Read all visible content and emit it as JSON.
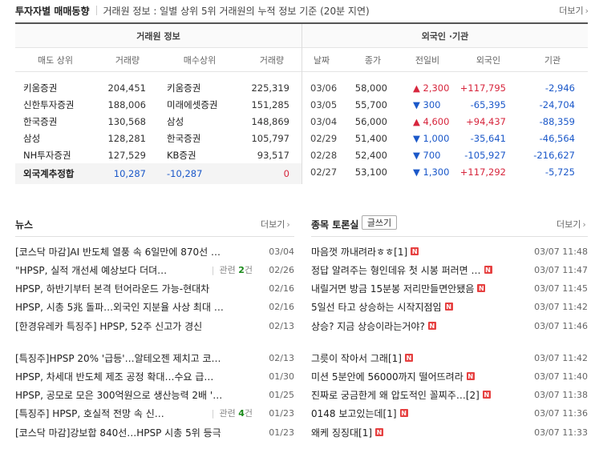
{
  "header": {
    "title": "투자자별 매매동향",
    "desc": "거래원 정보 : 일별 상위 5위 거래원의 누적 정보 기준 (20분 지연)",
    "more": "더보기"
  },
  "broker": {
    "group_title": "거래원 정보",
    "columns": [
      "매도 상위",
      "거래량",
      "매수상위",
      "거래량"
    ],
    "rows": [
      {
        "sell": "키움증권",
        "sell_vol": "204,451",
        "buy": "키움증권",
        "buy_vol": "225,319"
      },
      {
        "sell": "신한투자증권",
        "sell_vol": "188,006",
        "buy": "미래에셋증권",
        "buy_vol": "151,285"
      },
      {
        "sell": "한국증권",
        "sell_vol": "130,568",
        "buy": "삼성",
        "buy_vol": "148,869"
      },
      {
        "sell": "삼성",
        "sell_vol": "128,281",
        "buy": "한국증권",
        "buy_vol": "105,797"
      },
      {
        "sell": "NH투자증권",
        "sell_vol": "127,529",
        "buy": "KB증권",
        "buy_vol": "93,517"
      }
    ],
    "foreign": {
      "label": "외국계추정합",
      "sell_vol": "10,287",
      "buy_vol": "-10,287",
      "net": "0"
    }
  },
  "foreign_inst": {
    "group_title": "외국인 ·기관",
    "columns": [
      "날짜",
      "종가",
      "전일비",
      "외국인",
      "기관"
    ],
    "rows": [
      {
        "date": "03/06",
        "close": "58,000",
        "dir": "up",
        "change": "▲ 2,300",
        "foreign": "+117,795",
        "inst": "-2,946"
      },
      {
        "date": "03/05",
        "close": "55,700",
        "dir": "down",
        "change": "▼ 300",
        "foreign": "-65,395",
        "inst": "-24,704"
      },
      {
        "date": "03/04",
        "close": "56,000",
        "dir": "up",
        "change": "▲ 4,600",
        "foreign": "+94,437",
        "inst": "-88,359"
      },
      {
        "date": "02/29",
        "close": "51,400",
        "dir": "down",
        "change": "▼ 1,000",
        "foreign": "-35,641",
        "inst": "-46,564"
      },
      {
        "date": "02/28",
        "close": "52,400",
        "dir": "down",
        "change": "▼ 700",
        "foreign": "-105,927",
        "inst": "-216,627"
      },
      {
        "date": "02/27",
        "close": "53,100",
        "dir": "down",
        "change": "▼ 1,300",
        "foreign": "+117,292",
        "inst": "-5,725"
      }
    ]
  },
  "news": {
    "title": "뉴스",
    "more": "더보기",
    "group1": [
      {
        "text": "[코스닥 마감]AI 반도체 열풍 속 6일만에 870선 …",
        "rel": "",
        "cnt": "",
        "date": "03/04"
      },
      {
        "text": "\"HPSP, 실적 개선세 예상보다 더뎌…",
        "rel": "관련 ",
        "cnt": "2",
        "rel_suffix": "건",
        "date": "02/26"
      },
      {
        "text": "HPSP, 하반기부터 본격 턴어라운드 가능-현대차",
        "rel": "",
        "cnt": "",
        "date": "02/16"
      },
      {
        "text": "HPSP, 시총 5兆 돌파…외국인 지분율 사상 최대 …",
        "rel": "",
        "cnt": "",
        "date": "02/16"
      },
      {
        "text": "[한경유레카 특징주] HPSP, 52주 신고가 경신",
        "rel": "",
        "cnt": "",
        "date": "02/13"
      }
    ],
    "group2": [
      {
        "text": "[특징주]HPSP 20% '급등'…알테오젠 제치고 코…",
        "rel": "",
        "cnt": "",
        "date": "02/13"
      },
      {
        "text": "HPSP, 차세대 반도체 제조 공정 확대…수요 급…",
        "rel": "",
        "cnt": "",
        "date": "01/30"
      },
      {
        "text": "HPSP, 공모로 모은 300억원으로 생산능력 2배 '…",
        "rel": "",
        "cnt": "",
        "date": "01/25"
      },
      {
        "text": "[특징주] HPSP, 호실적 전망 속 신…",
        "rel": "관련 ",
        "cnt": "4",
        "rel_suffix": "건",
        "date": "01/23"
      },
      {
        "text": "[코스닥 마감]강보합 840선…HPSP 시총 5위 등극",
        "rel": "",
        "cnt": "",
        "date": "01/23"
      }
    ]
  },
  "board": {
    "title": "종목 토론실",
    "write": "글쓰기",
    "more": "더보기",
    "new_badge": "N",
    "group1": [
      {
        "text": "마음껏 까내려라ㅎㅎ[1]",
        "date": "03/07 11:48"
      },
      {
        "text": "정답 알려주는 형인데유 첫 시봉 퍼러면 …",
        "date": "03/07 11:47"
      },
      {
        "text": "내릴거면 방금 15분봉 저리만들면안됐음",
        "date": "03/07 11:45"
      },
      {
        "text": "5일선 타고 상승하는 시작지점임",
        "date": "03/07 11:42"
      },
      {
        "text": "상승? 지금 상승이라는거야?",
        "date": "03/07 11:46"
      }
    ],
    "group2": [
      {
        "text": "그릇이 작아서 그래[1]",
        "date": "03/07 11:42"
      },
      {
        "text": "미션 5분안에 56000까지 떨어뜨려라",
        "date": "03/07 11:40"
      },
      {
        "text": "진짜로 궁금한게 왜 압도적인 꼴찌주…[2]",
        "date": "03/07 11:38"
      },
      {
        "text": "0148 보고있는데[1]",
        "date": "03/07 11:36"
      },
      {
        "text": "왜케 징징대[1]",
        "date": "03/07 11:33"
      }
    ]
  }
}
